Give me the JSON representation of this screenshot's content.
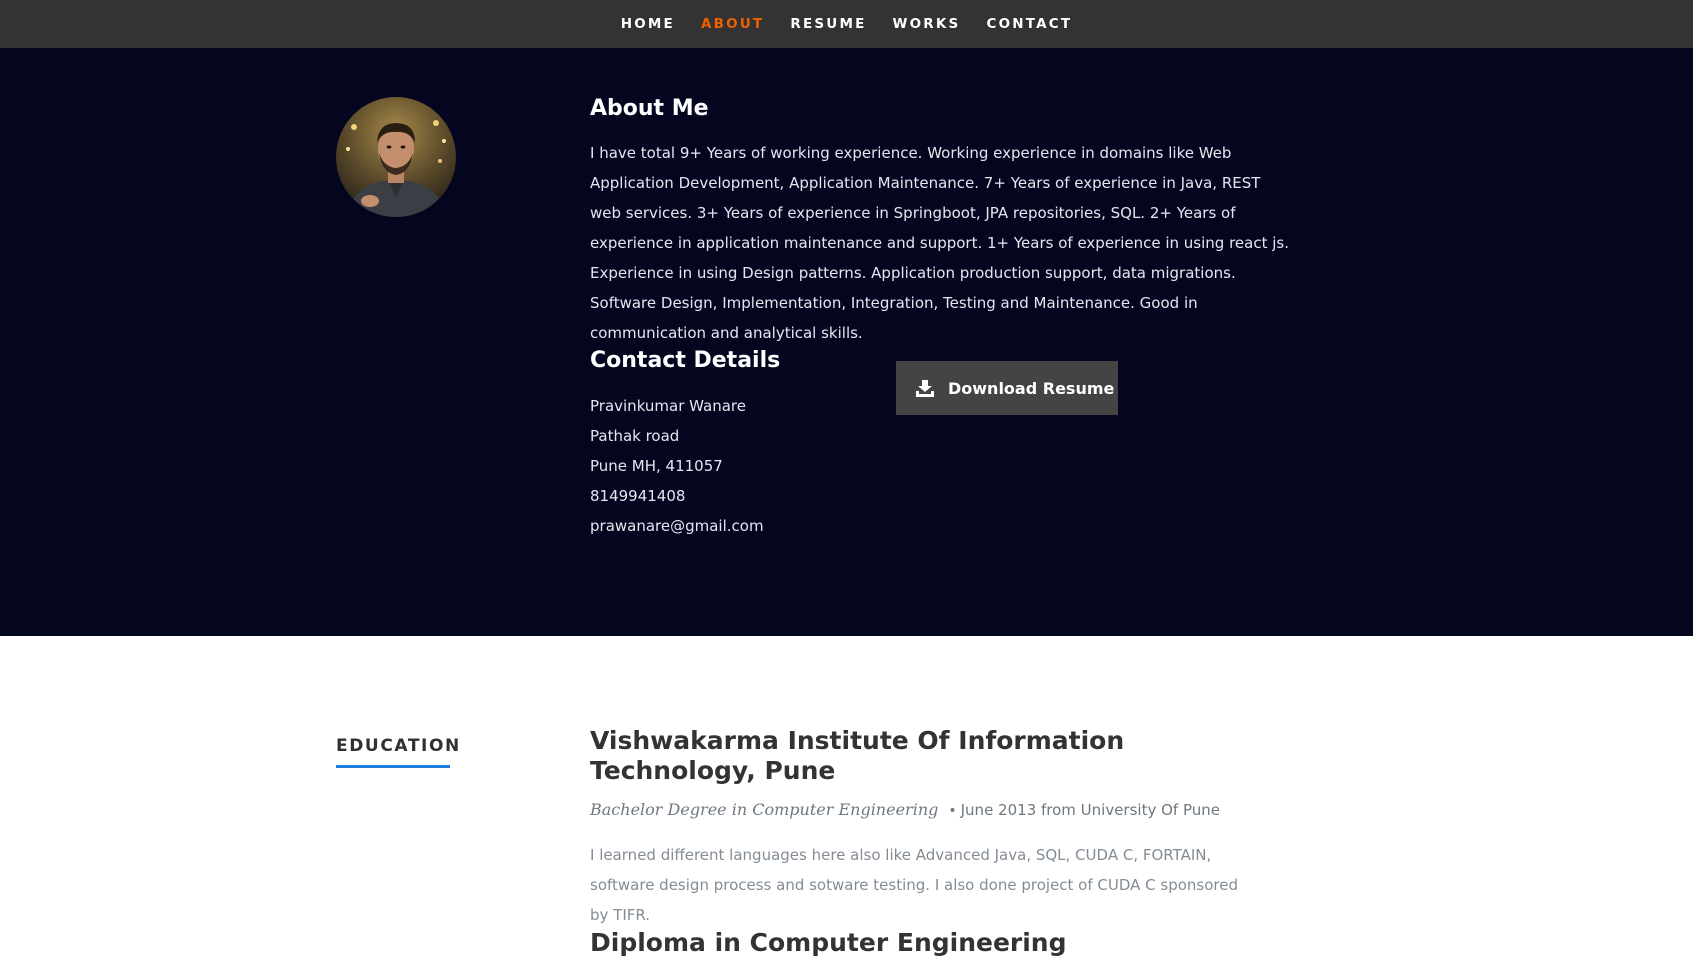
{
  "nav": {
    "items": [
      {
        "label": "HOME"
      },
      {
        "label": "ABOUT"
      },
      {
        "label": "RESUME"
      },
      {
        "label": "WORKS"
      },
      {
        "label": "CONTACT"
      }
    ],
    "active_color": "#F06000"
  },
  "about": {
    "title": "About Me",
    "text": "I have total 9+ Years of working experience. Working experience in domains like Web Application Development, Application Maintenance. 7+ Years of experience in Java, REST web services. 3+ Years of experience in Springboot, JPA repositories, SQL. 2+ Years of experience in application maintenance and support. 1+ Years of experience in using react js. Experience in using Design patterns. Application production support, data migrations. Software Design, Implementation, Integration, Testing and Maintenance. Good in communication and analytical skills.",
    "background": "#040620"
  },
  "contact": {
    "title": "Contact Details",
    "name": "Pravinkumar Wanare",
    "street": "Pathak road",
    "city": "Pune MH, 411057",
    "phone": "8149941408",
    "email": "prawanare@gmail.com"
  },
  "download": {
    "label": "Download Resume",
    "icon": "download-icon"
  },
  "education": {
    "heading": "EDUCATION",
    "accent": "#1f7fe0",
    "entries": [
      {
        "school": "Vishwakarma Institute Of Information Technology, Pune",
        "degree": "Bachelor Degree in Computer Engineering",
        "date": "June 2013 from University Of Pune",
        "description": "I learned different languages here also like Advanced Java, SQL, CUDA C, FORTAIN, software design process and sotware testing. I also done project of CUDA C sponsored by TIFR."
      },
      {
        "school": "Diploma in Computer Engineering"
      }
    ]
  }
}
